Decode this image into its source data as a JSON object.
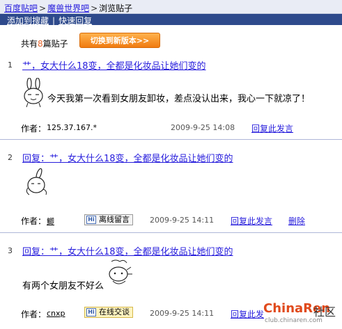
{
  "breadcrumb": {
    "items": [
      "百度贴吧",
      "魔兽世界吧",
      "浏览贴子"
    ],
    "separator": ">"
  },
  "toolbar": {
    "favorite_label": "添加到搜藏",
    "quick_reply_label": "快速回复",
    "divider": "|"
  },
  "summary": {
    "prefix": "共有",
    "count": "8",
    "suffix": "篇贴子",
    "switch_label": "切换到新版本>>"
  },
  "posts": [
    {
      "floor": "1",
      "title": "艹，女大什么18变，全都是化妆品让她们变的",
      "body": "今天我第一次看到女朋友卸妆，差点没认出来，我心一下就凉了！",
      "author_label": "作者：",
      "author": "125.37.167.*",
      "date": "2009-9-25 14:08",
      "reply_label": "回复此发言"
    },
    {
      "floor": "2",
      "title": "回复：艹，女大什么18变，全都是化妆品让她们变的",
      "body": "",
      "author_label": "作者：",
      "author": "鲫",
      "badge": "离线留言",
      "date": "2009-9-25 14:11",
      "reply_label": "回复此发言",
      "delete_label": "删除"
    },
    {
      "floor": "3",
      "title": "回复：艹，女大什么18变，全都是化妆品让她们变的",
      "body": "有两个女朋友不好么",
      "author_label": "作者：",
      "author": "cnxp",
      "badge": "在线交谈",
      "date": "2009-9-25 14:11",
      "reply_label": "回复此发"
    }
  ],
  "badge_icon_text": "Hi",
  "watermark": {
    "brand": "ChinaRen",
    "suffix": "社区",
    "url": "club.chinaren.com"
  },
  "colors": {
    "link": "#261CDC",
    "toolbar_bg": "#2E4A8C",
    "accent": "#F07B10"
  }
}
